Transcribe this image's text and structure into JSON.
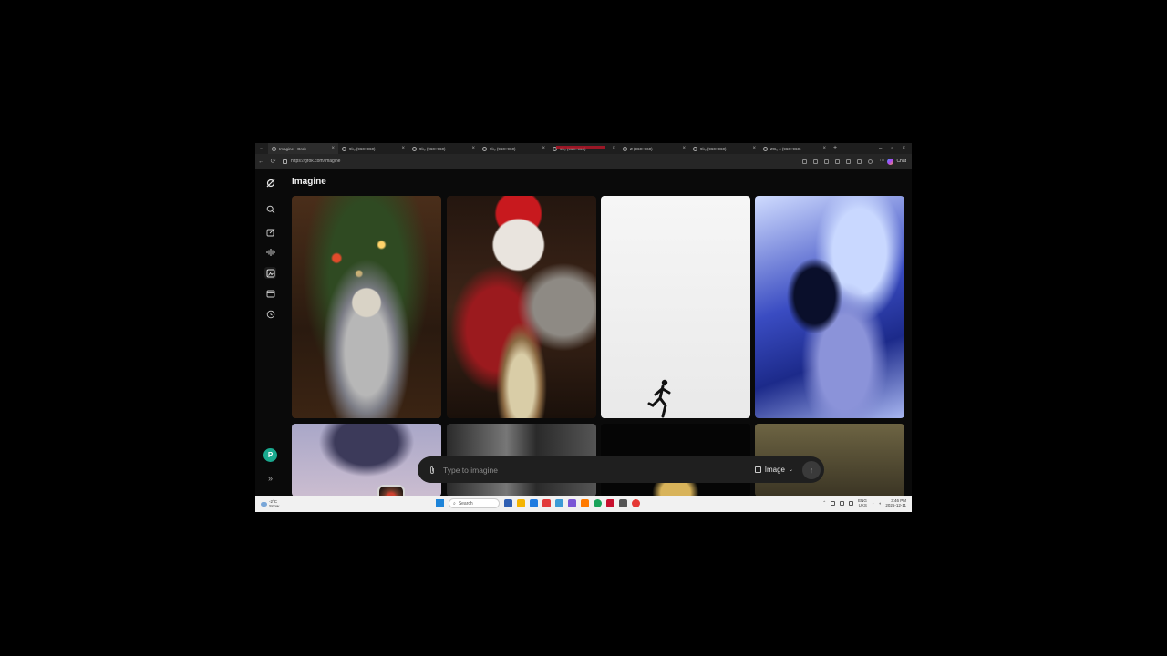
{
  "browser": {
    "tabs": [
      {
        "title": "Imagine - Grok",
        "active": true
      },
      {
        "title": "9k₀ (960×960)"
      },
      {
        "title": "9k₀ (960×960)"
      },
      {
        "title": "9k₀ (960×960)"
      },
      {
        "title": "9k₀ (960×960)"
      },
      {
        "title": "Z (960×960)"
      },
      {
        "title": "9k₀ (960×960)"
      },
      {
        "title": "ZG₀ c (960×960)"
      }
    ],
    "url": "https://grok.com/imagine",
    "copilot_label": "Chat"
  },
  "app": {
    "title": "Imagine",
    "sidebar": {
      "icons": [
        "search-icon",
        "edit-icon",
        "voice-icon",
        "imagine-icon",
        "projects-icon",
        "history-icon"
      ],
      "active_index": 3,
      "avatar_initial": "P",
      "expand_label": "»"
    },
    "gallery": [
      {
        "description": "cat wrapped in foil under a christmas tree"
      },
      {
        "description": "santa claus with a cat and cookies"
      },
      {
        "description": "silhouette figure running on white"
      },
      {
        "description": "blue chrome liquid figure"
      },
      {
        "description": "dark ellipse over pastel"
      },
      {
        "description": "marble texture"
      },
      {
        "description": "dark scene with golden light"
      },
      {
        "description": "muted olive scene"
      }
    ],
    "prompt": {
      "placeholder": "Type to imagine",
      "mode_label": "Image",
      "send_icon": "↑"
    }
  },
  "taskbar": {
    "weather": {
      "temp": "-2°C",
      "condition": "Snow"
    },
    "search_label": "Search",
    "tray": {
      "lang": "ENG",
      "region": "UKS",
      "time": "3:46 PM",
      "date": "2025-12-11"
    },
    "app_colors": [
      "#2f5fb3",
      "#f4b400",
      "#1f7be0",
      "#e23b3b",
      "#3c9bd6",
      "#7b57d6",
      "#ff7a00",
      "#19a35a",
      "#c8102e",
      "#555555",
      "#e53935"
    ]
  }
}
